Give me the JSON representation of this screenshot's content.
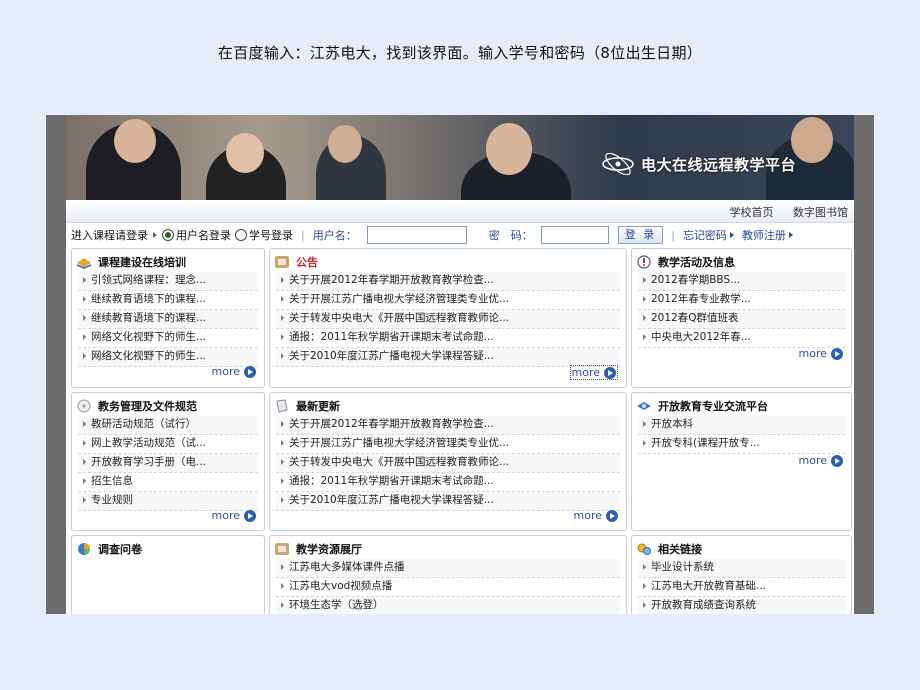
{
  "caption": "在百度输入：江苏电大，找到该界面。输入学号和密码（8位出生日期）",
  "banner": {
    "brand": "电大在线远程教学平台"
  },
  "topnav": {
    "links": [
      "学校首页",
      "数字图书馆"
    ]
  },
  "login": {
    "lead": "进入课程请登录",
    "option_username": "用户名登录",
    "option_studentid": "学号登录",
    "username_label": "用户名：",
    "password_label": "密　码：",
    "submit": "登 录",
    "forgot": "忘记密码",
    "teacher_register": "教师注册"
  },
  "panels": {
    "courses": {
      "title": "课程建设在线培训",
      "items": [
        "引领式网络课程：理念...",
        "继续教育语境下的课程...",
        "继续教育语境下的课程...",
        "网络文化视野下的师生...",
        "网络文化视野下的师生..."
      ],
      "more": "more"
    },
    "notice": {
      "title": "公告",
      "items": [
        "关于开展2012年春学期开放教育教学检查...",
        "关于开展江苏广播电视大学经济管理类专业优...",
        "关于转发中央电大《开展中国远程教育教师论...",
        "通报：2011年秋学期省开课期末考试命题...",
        "关于2010年度江苏广播电视大学课程答疑..."
      ],
      "more": "more"
    },
    "activities": {
      "title": "教学活动及信息",
      "items": [
        "2012春学期BBS...",
        "2012年春专业教学...",
        "2012春Q群值班表",
        "中央电大2012年春..."
      ],
      "more": "more"
    },
    "admin": {
      "title": "教务管理及文件规范",
      "items": [
        "教研活动规范（试行）",
        "网上教学活动规范（试...",
        "开放教育学习手册（电...",
        "招生信息",
        "专业规则"
      ],
      "more": "more"
    },
    "updates": {
      "title": "最新更新",
      "items": [
        "关于开展2012年春学期开放教育教学检查...",
        "关于开展江苏广播电视大学经济管理类专业优...",
        "关于转发中央电大《开展中国远程教育教师论...",
        "通报：2011年秋学期省开课期末考试命题...",
        "关于2010年度江苏广播电视大学课程答疑..."
      ],
      "more": "more"
    },
    "exchange": {
      "title": "开放教育专业交流平台",
      "items": [
        "开放本科",
        "开放专科(课程开放专..."
      ],
      "more": "more"
    },
    "survey": {
      "title": "调查问卷"
    },
    "resources": {
      "title": "教学资源展厅",
      "items": [
        "江苏电大多媒体课件点播",
        "江苏电大vod视频点播",
        "环境生态学（选登）"
      ]
    },
    "links": {
      "title": "相关链接",
      "items": [
        "毕业设计系统",
        "江苏电大开放教育基础...",
        "开放教育成绩查询系统"
      ]
    }
  }
}
